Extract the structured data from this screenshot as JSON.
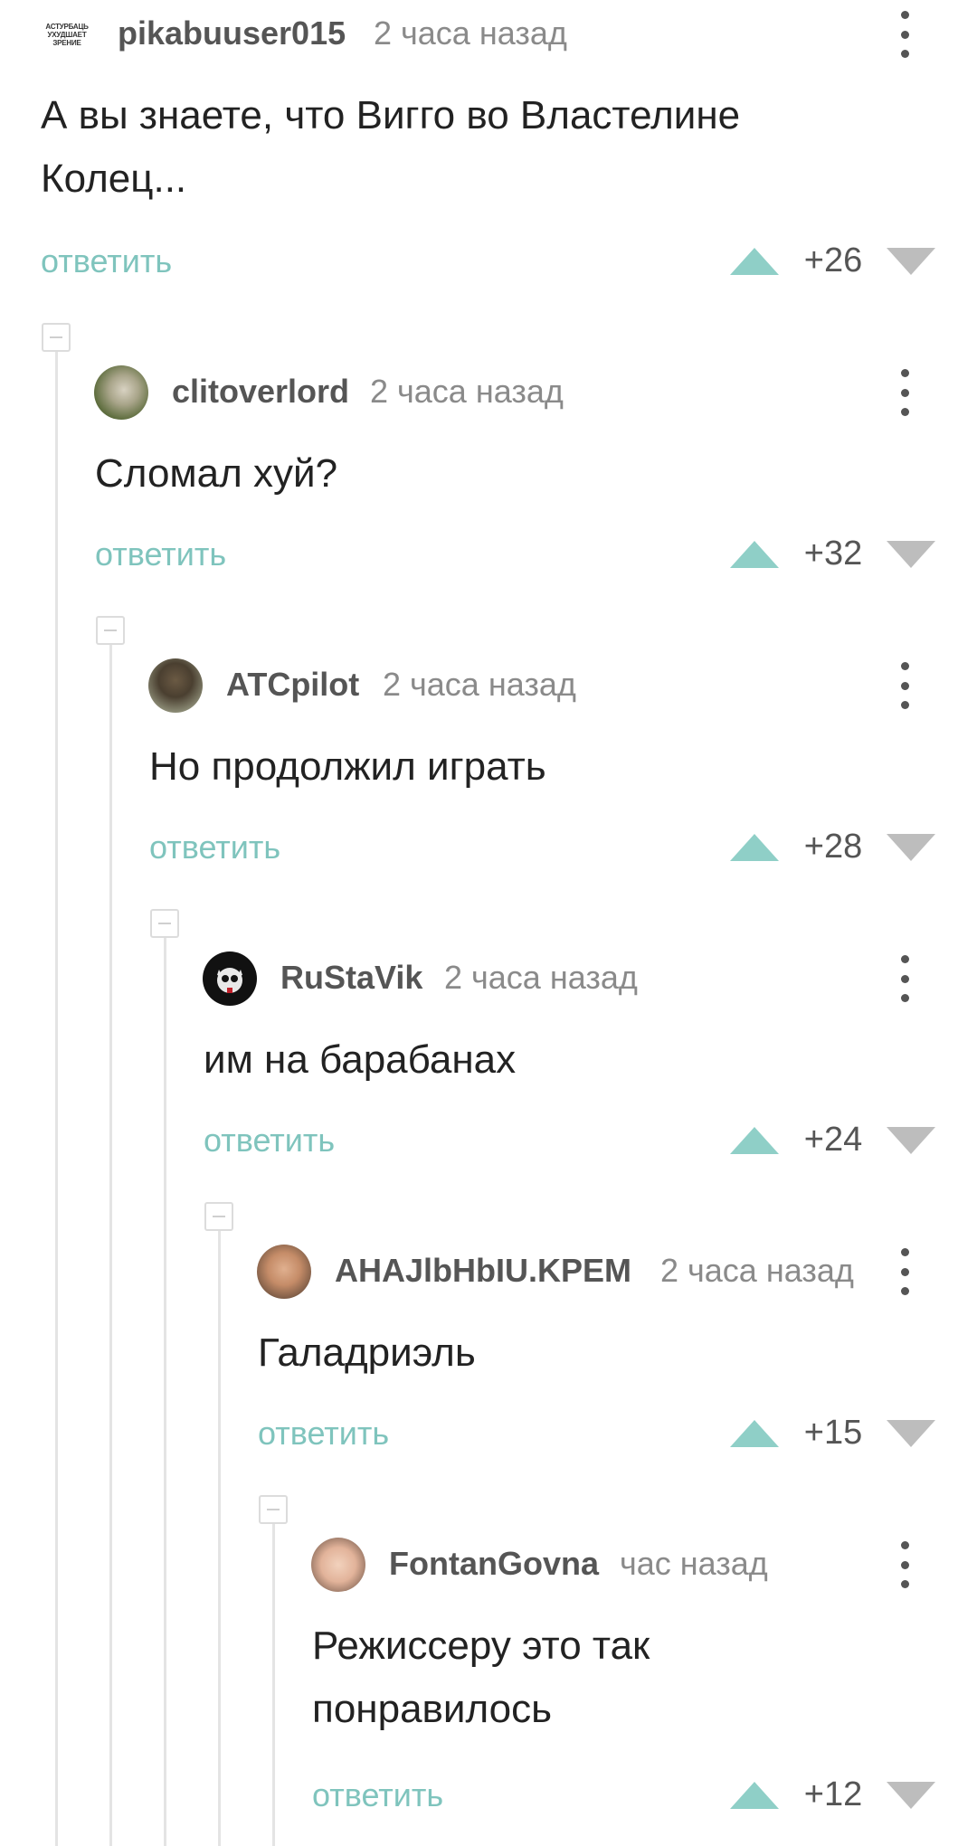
{
  "comments": [
    {
      "author": "pikabuuser015",
      "time": "2 часа назад",
      "text": "А вы знаете, что Вигго во Властелине Колец...",
      "reply_label": "ответить",
      "score": "+26",
      "avatar_text": "АСТУРБАЦЬ УХУДШАЕТ ЗРЕНИЕ"
    },
    {
      "author": "clitoverlord",
      "time": "2 часа назад",
      "text": "Сломал хуй?",
      "reply_label": "ответить",
      "score": "+32"
    },
    {
      "author": "ATCpilot",
      "time": "2 часа назад",
      "text": "Но продолжил играть",
      "reply_label": "ответить",
      "score": "+28"
    },
    {
      "author": "RuStaVik",
      "time": "2 часа назад",
      "text": "им на барабанах",
      "reply_label": "ответить",
      "score": "+24"
    },
    {
      "author": "AHAJlbHbIU.KPEM",
      "time": "2 часа назад",
      "text": "Галадриэль",
      "reply_label": "ответить",
      "score": "+15"
    },
    {
      "author": "FontanGovna",
      "time": "час назад",
      "text": "Режиссеру это так понравилось",
      "reply_label": "ответить",
      "score": "+12"
    }
  ],
  "colors": {
    "reply": "#7fc4bd",
    "upvote": "#8fcfc7",
    "downvote": "#bdbdbd",
    "thread_line": "#e4e4e4"
  },
  "icons": {
    "menu": "more-vertical-icon",
    "upvote": "triangle-up-icon",
    "downvote": "triangle-down-icon",
    "collapse": "collapse-minus-icon"
  }
}
